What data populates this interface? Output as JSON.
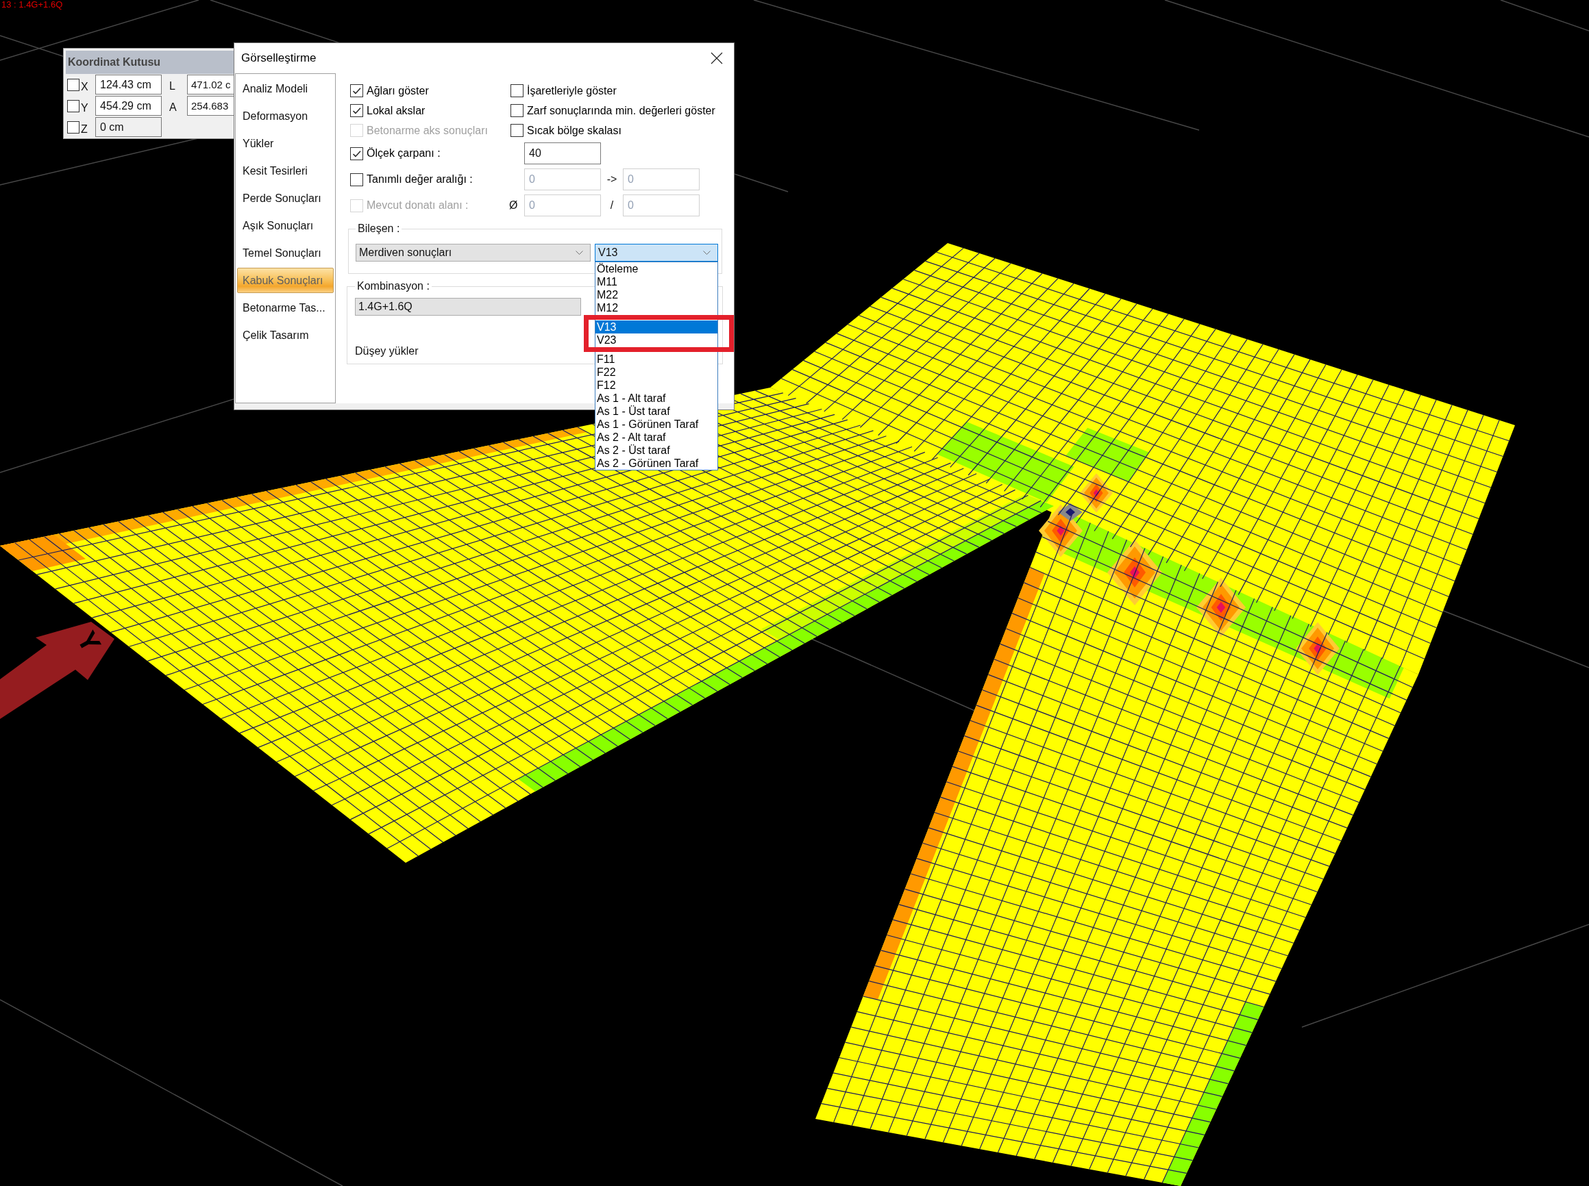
{
  "viewport": {
    "combination_label": "13 : 1.4G+1.6Q",
    "axis_label": "Y"
  },
  "coordinate_box": {
    "title": "Koordinat Kutusu",
    "rows": [
      {
        "checked": false,
        "axis": "X",
        "value": "124.43 cm",
        "disabled": false,
        "extra_label": "L",
        "extra_value": "471.02 c"
      },
      {
        "checked": false,
        "axis": "Y",
        "value": "454.29 cm",
        "disabled": false,
        "extra_label": "A",
        "extra_value": "254.683"
      },
      {
        "checked": false,
        "axis": "Z",
        "value": "0 cm",
        "disabled": true
      }
    ]
  },
  "dialog": {
    "title": "Görselleştirme",
    "sidebar": {
      "items": [
        {
          "label": "Analiz Modeli",
          "selected": false
        },
        {
          "label": "Deformasyon",
          "selected": false
        },
        {
          "label": "Yükler",
          "selected": false
        },
        {
          "label": "Kesit Tesirleri",
          "selected": false
        },
        {
          "label": "Perde Sonuçları",
          "selected": false
        },
        {
          "label": "Aşık Sonuçları",
          "selected": false
        },
        {
          "label": "Temel Sonuçları",
          "selected": false
        },
        {
          "label": "Kabuk Sonuçları",
          "selected": true
        },
        {
          "label": "Betonarme Tas...",
          "selected": false
        },
        {
          "label": "Çelik Tasarım",
          "selected": false
        }
      ]
    },
    "option_rows": [
      {
        "kind": "pair",
        "left": {
          "label": "Ağları göster",
          "checked": true,
          "disabled": false
        },
        "right": {
          "label": "İşaretleriyle göster",
          "checked": false,
          "disabled": false
        }
      },
      {
        "kind": "pair",
        "left": {
          "label": "Lokal akslar",
          "checked": true,
          "disabled": false
        },
        "right": {
          "label": "Zarf sonuçlarında min. değerleri göster",
          "checked": false,
          "disabled": false
        }
      },
      {
        "kind": "pair",
        "left": {
          "label": "Betonarme aks sonuçları",
          "checked": false,
          "disabled": true
        },
        "right": {
          "label": "Sıcak bölge skalası",
          "checked": false,
          "disabled": false
        }
      },
      {
        "kind": "fields",
        "left": {
          "label": "Ölçek çarpanı :",
          "checked": true,
          "disabled": false
        },
        "fields": [
          {
            "value": "40",
            "disabled": false
          }
        ]
      },
      {
        "kind": "fields",
        "left": {
          "label": "Tanımlı değer aralığı :",
          "checked": false,
          "disabled": false
        },
        "fields": [
          {
            "value": "0",
            "disabled": true
          },
          {
            "value": "0",
            "disabled": true
          }
        ],
        "separator": "->"
      },
      {
        "kind": "fields",
        "left": {
          "label": "Mevcut donatı alanı :",
          "checked": false,
          "disabled": true
        },
        "prefix": "Ø",
        "fields": [
          {
            "value": "0",
            "disabled": true
          },
          {
            "value": "0",
            "disabled": true
          }
        ],
        "separator": "/"
      }
    ],
    "component_group": {
      "title": "Bileşen :",
      "result_type": "Merdiven sonuçları",
      "component": {
        "value": "V13",
        "expanded": true,
        "options": [
          {
            "label": "Öteleme",
            "selected": false,
            "annotated": false
          },
          {
            "label": "M11",
            "selected": false,
            "annotated": false
          },
          {
            "label": "M22",
            "selected": false,
            "annotated": false
          },
          {
            "label": "M12",
            "selected": false,
            "annotated": false
          },
          {
            "label": "V13",
            "selected": true,
            "annotated": true
          },
          {
            "label": "V23",
            "selected": false,
            "annotated": true
          },
          {
            "label": "F11",
            "selected": false,
            "annotated": false
          },
          {
            "label": "F22",
            "selected": false,
            "annotated": false
          },
          {
            "label": "F12",
            "selected": false,
            "annotated": false
          },
          {
            "label": "As 1 - Alt taraf",
            "selected": false,
            "annotated": false
          },
          {
            "label": "As 1 - Üst taraf",
            "selected": false,
            "annotated": false
          },
          {
            "label": "As 1 - Görünen Taraf",
            "selected": false,
            "annotated": false
          },
          {
            "label": "As 2 - Alt taraf",
            "selected": false,
            "annotated": false
          },
          {
            "label": "As 2 - Üst taraf",
            "selected": false,
            "annotated": false
          },
          {
            "label": "As 2 - Görünen Taraf",
            "selected": false,
            "annotated": false
          }
        ]
      }
    },
    "combination_group": {
      "title": "Kombinasyon :",
      "combination": "1.4G+1.6Q",
      "load_type": "Düşey yükler"
    }
  }
}
